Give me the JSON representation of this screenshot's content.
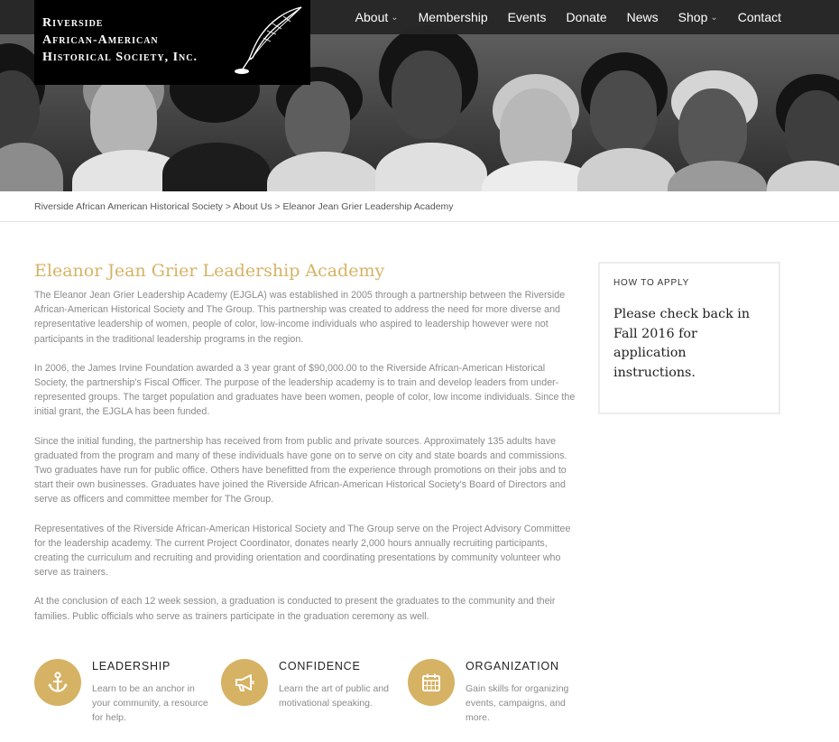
{
  "logo": {
    "line1": "Riverside",
    "line2": "African-American",
    "line3": "Historical Society, Inc."
  },
  "nav": {
    "items": [
      {
        "label": "About",
        "dropdown": true
      },
      {
        "label": "Membership",
        "dropdown": false
      },
      {
        "label": "Events",
        "dropdown": false
      },
      {
        "label": "Donate",
        "dropdown": false
      },
      {
        "label": "News",
        "dropdown": false
      },
      {
        "label": "Shop",
        "dropdown": true
      },
      {
        "label": "Contact",
        "dropdown": false
      }
    ],
    "caret": "⌄"
  },
  "breadcrumb": {
    "text": "Riverside African American Historical Society > About Us > Eleanor Jean Grier Leadership Academy"
  },
  "main": {
    "title": "Eleanor Jean Grier Leadership Academy",
    "paragraphs": [
      "The Eleanor Jean Grier Leadership Academy (EJGLA) was established in 2005 through a partnership between the Riverside African-American Historical Society and The Group. This partnership was created to address the need for more diverse and representative leadership of women, people of color, low-income individuals who aspired to leadership however were not participants in the traditional leadership programs in the region.",
      "In 2006, the James Irvine Foundation awarded a 3 year grant of $90,000.00 to the Riverside African-American Historical Society, the partnership's Fiscal Officer.  The purpose of the leadership academy is to train and develop leaders from under- represented groups.  The target population and graduates have been women, people of color, low income individuals.  Since the initial grant, the EJGLA has been funded.",
      "Since the initial funding, the partnership has received from from public and private sources.  Approximately 135 adults have graduated from the program and many of these individuals have gone on to serve on city and state boards and commissions.  Two graduates have run for public office.  Others have benefitted from the experience through promotions on their jobs and to start their own businesses.  Graduates have joined the Riverside African-American Historical Society's Board of Directors and serve as officers and committee member for The Group.",
      "Representatives of the Riverside African-American Historical Society and The Group serve on the Project Advisory Committee for the leadership academy.  The current Project Coordinator, donates nearly 2,000 hours annually recruiting participants, creating the curriculum and recruiting and providing orientation and coordinating presentations by community volunteer who serve as trainers.",
      "At the conclusion of each 12 week session, a graduation is conducted to present the graduates to the community and their families.  Public officials who serve as trainers participate in the graduation ceremony as well."
    ]
  },
  "sidebar": {
    "heading": "HOW TO APPLY",
    "text": "Please check back in Fall 2016 for application instructions."
  },
  "features": [
    {
      "icon": "anchor-icon",
      "title": "LEADERSHIP",
      "desc": "Learn to be an anchor in your community, a resource for help."
    },
    {
      "icon": "megaphone-icon",
      "title": "CONFIDENCE",
      "desc": "Learn the art of public and motivational speaking."
    },
    {
      "icon": "calendar-icon",
      "title": "ORGANIZATION",
      "desc": "Gain skills for organizing events, campaigns, and more."
    }
  ],
  "colors": {
    "accent": "#d6b264",
    "nav_bg": "#282828",
    "body_text": "#8a8a8a"
  }
}
